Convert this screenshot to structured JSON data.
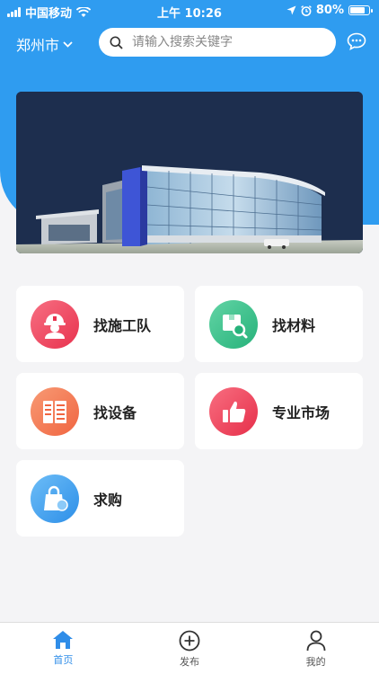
{
  "status_bar": {
    "carrier": "中国移动",
    "time": "上午 10:26",
    "battery": "80%",
    "battery_level": 0.8,
    "icons": [
      "signal-icon",
      "wifi-icon",
      "location-icon",
      "alarm-icon",
      "battery-icon"
    ]
  },
  "header": {
    "city": "郑州市",
    "search_placeholder": "请输入搜索关键字"
  },
  "categories": [
    {
      "label": "找施工队",
      "icon": "worker-icon",
      "color": "#f0506a"
    },
    {
      "label": "找材料",
      "icon": "box-search-icon",
      "color": "#38c48e"
    },
    {
      "label": "找设备",
      "icon": "equipment-icon",
      "color": "#f57b5a"
    },
    {
      "label": "专业市场",
      "icon": "thumbs-up-icon",
      "color": "#f2455c"
    },
    {
      "label": "求购",
      "icon": "shopping-bag-icon",
      "color": "#4aa6f2"
    }
  ],
  "tabbar": {
    "tabs": [
      {
        "label": "首页",
        "icon": "home-icon",
        "active": true
      },
      {
        "label": "发布",
        "icon": "plus-circle-icon",
        "active": false
      },
      {
        "label": "我的",
        "icon": "user-icon",
        "active": false
      }
    ]
  },
  "colors": {
    "primary": "#2f9cf0",
    "active_tab": "#2f8de8"
  }
}
